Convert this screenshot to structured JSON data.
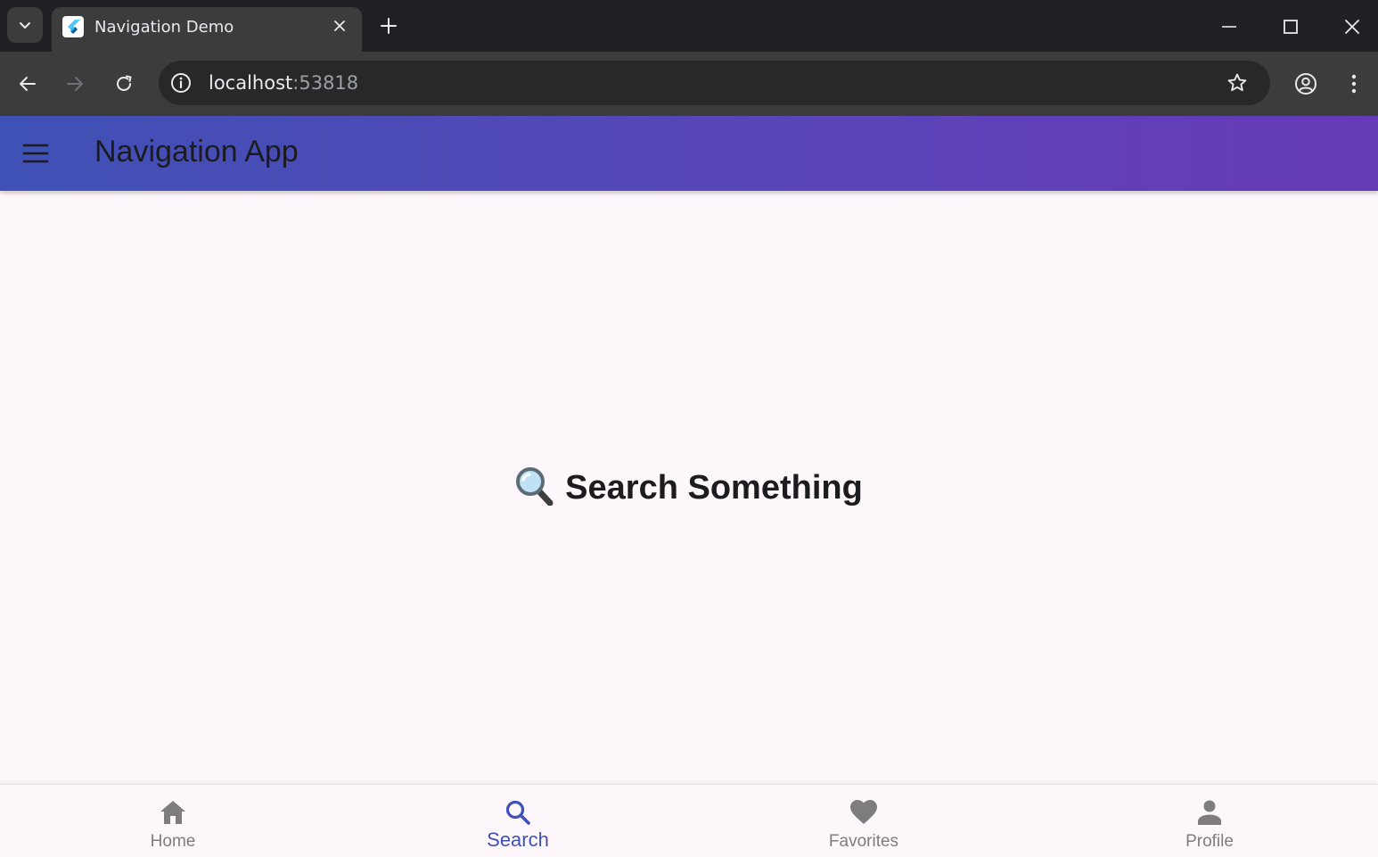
{
  "browser": {
    "tab_title": "Navigation Demo",
    "url_host": "localhost",
    "url_port": ":53818"
  },
  "appbar": {
    "title": "Navigation App",
    "gradient": [
      "#3f51b5",
      "#673ab7"
    ]
  },
  "content": {
    "emoji": "🔍",
    "message": "Search Something"
  },
  "bottom_nav": {
    "active_color": "#3f51b5",
    "inactive_color": "#7d7d7d",
    "items": [
      {
        "label": "Home",
        "icon": "home-icon",
        "active": false
      },
      {
        "label": "Search",
        "icon": "search-icon",
        "active": true
      },
      {
        "label": "Favorites",
        "icon": "heart-icon",
        "active": false
      },
      {
        "label": "Profile",
        "icon": "person-icon",
        "active": false
      }
    ]
  }
}
